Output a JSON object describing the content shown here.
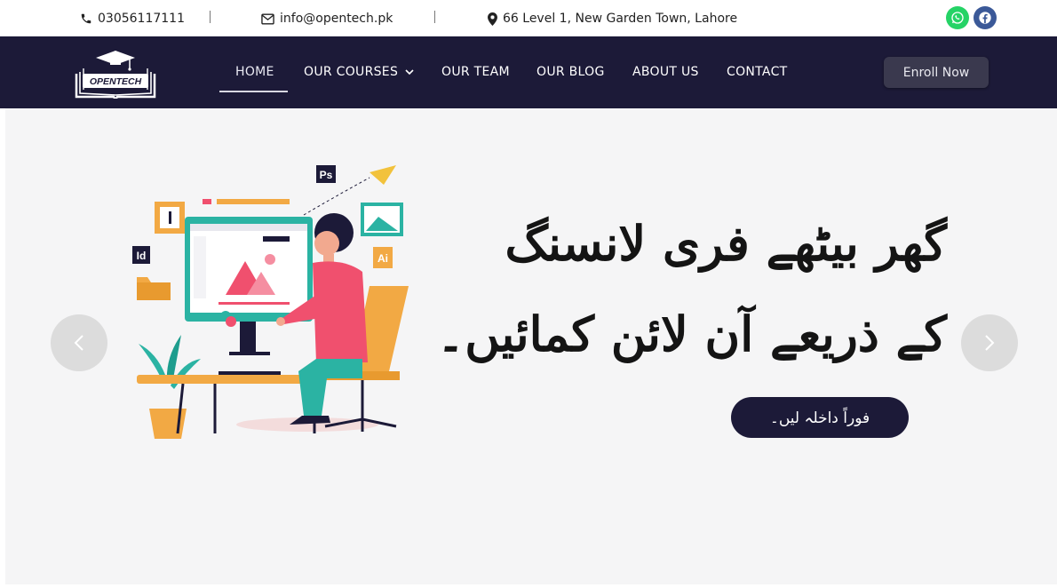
{
  "topbar": {
    "phone": "03056117111",
    "email": "info@opentech.pk",
    "address": "66 Level 1, New Garden Town, Lahore",
    "whatsapp_color": "#25d366",
    "facebook_color": "#3b5998"
  },
  "nav": {
    "logo_text": "OPENTECH",
    "items": [
      {
        "label": "HOME"
      },
      {
        "label": "OUR COURSES"
      },
      {
        "label": "OUR TEAM"
      },
      {
        "label": "OUR BLOG"
      },
      {
        "label": "ABOUT US"
      },
      {
        "label": "CONTACT"
      }
    ],
    "enroll_label": "Enroll Now",
    "bg_color": "#1c1a38"
  },
  "hero": {
    "headline_line1": "گھر بیٹھے فری لانسنگ",
    "headline_line2": "کے ذریعے آن لائن کمائیں۔",
    "cta_label": "فوراً داخلہ لیں۔",
    "illustration_badges": {
      "ps": "Ps",
      "id": "Id",
      "ai": "Ai"
    }
  }
}
